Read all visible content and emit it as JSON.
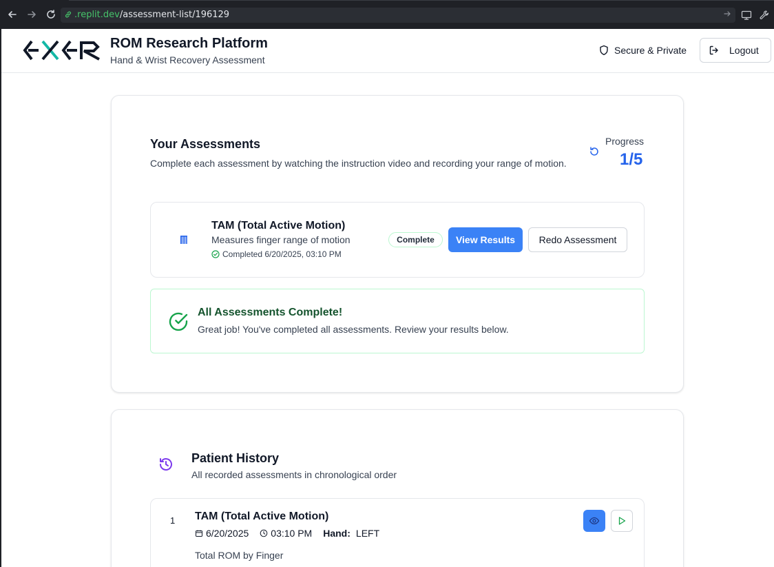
{
  "browser": {
    "url_domain": ".replit.dev",
    "url_path": "/assessment-list/196129",
    "icons": [
      "back-arrow-icon",
      "forward-arrow-icon",
      "reload-icon",
      "link-icon",
      "go-arrow-icon",
      "monitor-icon",
      "wrench-icon"
    ]
  },
  "header": {
    "title": "ROM Research Platform",
    "subtitle": "Hand & Wrist Recovery Assessment",
    "secure_label": "Secure & Private",
    "logout_label": "Logout"
  },
  "assessments": {
    "title": "Your Assessments",
    "description": "Complete each assessment by watching the instruction video and recording your range of motion.",
    "progress_label": "Progress",
    "progress_value": "1/5",
    "items": [
      {
        "title": "TAM (Total Active Motion)",
        "description": "Measures finger range of motion",
        "completed_text": "Completed 6/20/2025, 03:10 PM",
        "status_badge": "Complete",
        "view_results_label": "View Results",
        "redo_label": "Redo Assessment"
      }
    ],
    "all_complete": {
      "title": "All Assessments Complete!",
      "message": "Great job! You've completed all assessments. Review your results below."
    }
  },
  "history": {
    "title": "Patient History",
    "description": "All recorded assessments in chronological order",
    "items": [
      {
        "index": "1",
        "title": "TAM (Total Active Motion)",
        "date": "6/20/2025",
        "time": "03:10 PM",
        "hand_label": "Hand:",
        "hand_value": "LEFT",
        "subheading": "Total ROM by Finger"
      }
    ]
  },
  "colors": {
    "accent_blue": "#3b82f6",
    "progress_blue": "#2563eb",
    "success_green": "#16a34a",
    "history_purple": "#7c3aed",
    "logo_teal": "#14b8a6"
  }
}
